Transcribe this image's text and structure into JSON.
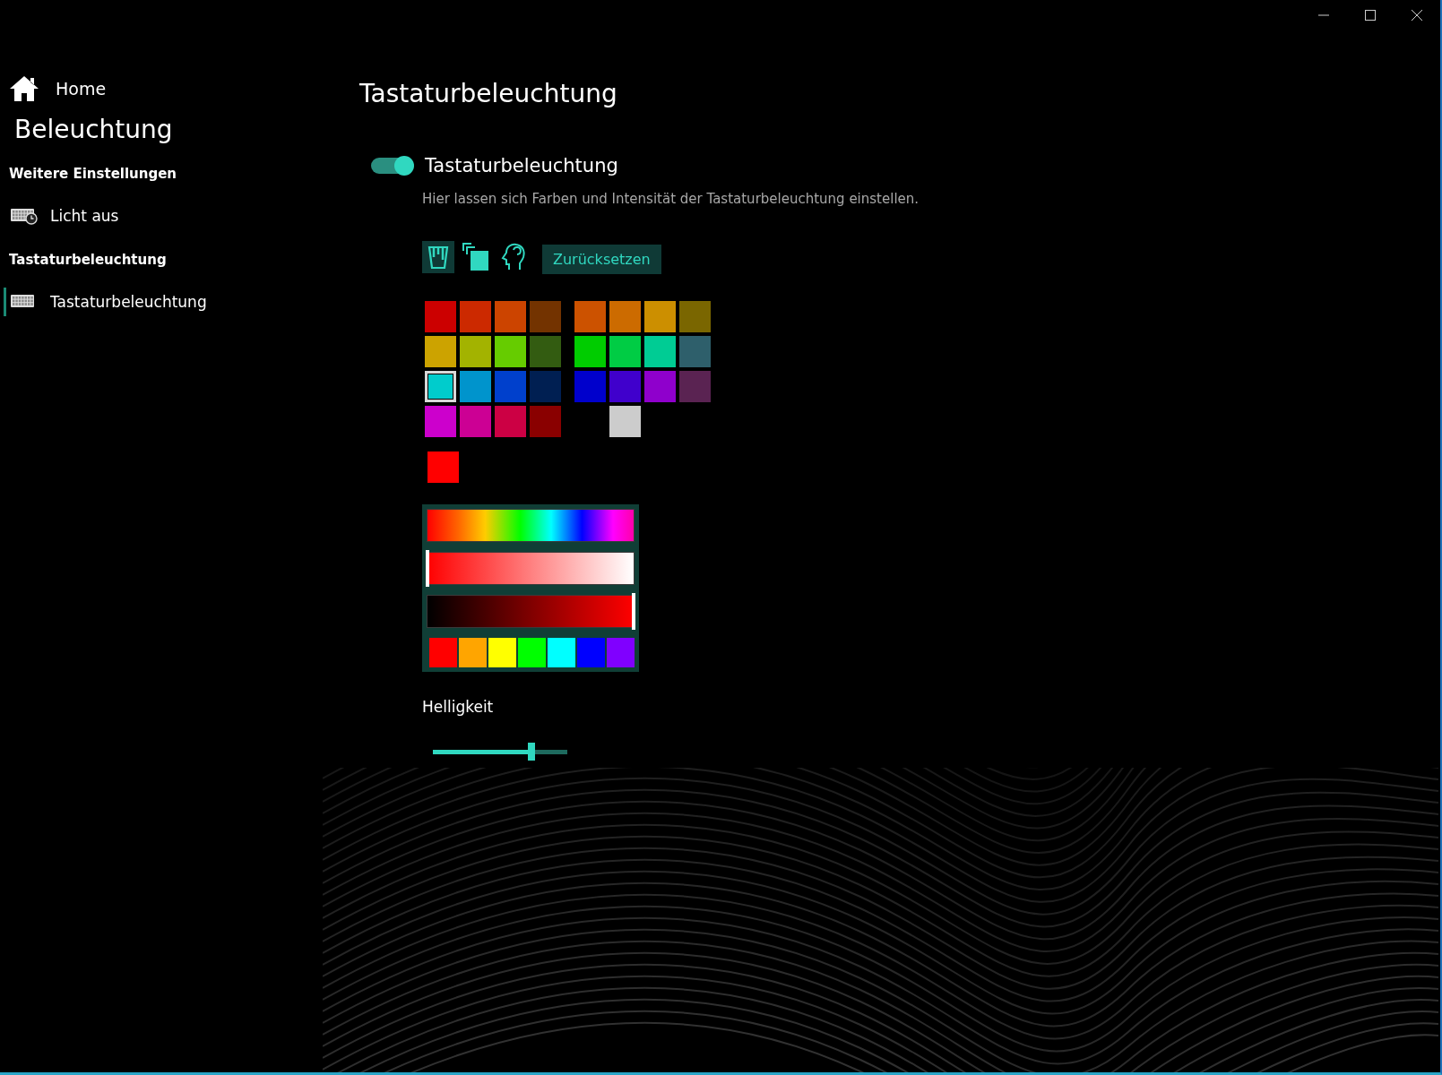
{
  "sidebar": {
    "home": {
      "label": "Home"
    },
    "title": "Beleuchtung",
    "sections": [
      {
        "heading": "Weitere Einstellungen",
        "items": [
          {
            "label": "Licht aus",
            "kind": "keyboard-clock",
            "selected": false
          }
        ]
      },
      {
        "heading": "Tastaturbeleuchtung",
        "items": [
          {
            "label": "Tastaturbeleuchtung",
            "kind": "keyboard",
            "selected": true
          }
        ]
      }
    ]
  },
  "page": {
    "title": "Tastaturbeleuchtung",
    "toggle": {
      "label": "Tastaturbeleuchtung",
      "on": true
    },
    "description": "Hier lassen sich Farben und Intensität der Tastaturbeleuchtung einstellen.",
    "tools": [
      {
        "kind": "bucket",
        "selected": true
      },
      {
        "kind": "copy",
        "selected": false
      },
      {
        "kind": "head",
        "selected": false
      }
    ],
    "reset_button": "Zurücksetzen",
    "swatch_groups": [
      {
        "swatches": [
          {
            "kind": "swatch",
            "color": "#cc0000",
            "selected": false
          },
          {
            "kind": "swatch",
            "color": "#cc2900",
            "selected": false
          },
          {
            "kind": "swatch",
            "color": "#cc4400",
            "selected": false
          },
          {
            "kind": "swatch",
            "color": "#733300",
            "selected": false
          },
          {
            "kind": "swatch",
            "color": "#cca300",
            "selected": false
          },
          {
            "kind": "swatch",
            "color": "#a3b300",
            "selected": false
          },
          {
            "kind": "swatch",
            "color": "#66cc00",
            "selected": false
          },
          {
            "kind": "swatch",
            "color": "#335c11",
            "selected": false
          },
          {
            "kind": "swatch",
            "color": "#00cccc",
            "selected": true
          },
          {
            "kind": "swatch",
            "color": "#0094cc",
            "selected": false
          },
          {
            "kind": "swatch",
            "color": "#0040cc",
            "selected": false
          },
          {
            "kind": "swatch",
            "color": "#001f52",
            "selected": false
          },
          {
            "kind": "swatch",
            "color": "#cc00cc",
            "selected": false
          },
          {
            "kind": "swatch",
            "color": "#cc0094",
            "selected": false
          },
          {
            "kind": "swatch",
            "color": "#cc0044",
            "selected": false
          },
          {
            "kind": "swatch",
            "color": "#8a0000",
            "selected": false
          }
        ]
      },
      {
        "swatches": [
          {
            "kind": "swatch",
            "color": "#cc5200",
            "selected": false
          },
          {
            "kind": "swatch",
            "color": "#cc6b00",
            "selected": false
          },
          {
            "kind": "swatch",
            "color": "#cc8f00",
            "selected": false
          },
          {
            "kind": "swatch",
            "color": "#7a6600",
            "selected": false
          },
          {
            "kind": "swatch",
            "color": "#00cc00",
            "selected": false
          },
          {
            "kind": "swatch",
            "color": "#00cc44",
            "selected": false
          },
          {
            "kind": "swatch",
            "color": "#00cc94",
            "selected": false
          },
          {
            "kind": "swatch",
            "color": "#2e5f6b",
            "selected": false
          },
          {
            "kind": "swatch",
            "color": "#0000cc",
            "selected": false
          },
          {
            "kind": "swatch",
            "color": "#4000cc",
            "selected": false
          },
          {
            "kind": "swatch",
            "color": "#8f00cc",
            "selected": false
          },
          {
            "kind": "swatch",
            "color": "#5a2352",
            "selected": false
          },
          {
            "kind": "blank"
          },
          {
            "kind": "swatch",
            "color": "#cccccc",
            "selected": false
          },
          {
            "kind": "blank"
          },
          {
            "kind": "blank"
          }
        ]
      }
    ],
    "current_color": {
      "color": "#ff0000"
    },
    "picker": {
      "saturation": {
        "level": 0
      },
      "value": {
        "level": 1
      },
      "presets": [
        {
          "color": "#ff0000"
        },
        {
          "color": "#ffa500"
        },
        {
          "color": "#ffff00"
        },
        {
          "color": "#00ff00"
        },
        {
          "color": "#00ffff"
        },
        {
          "color": "#0000ff"
        },
        {
          "color": "#8000ff"
        }
      ]
    },
    "brightness": {
      "label": "Helligkeit",
      "level": 0.73
    }
  }
}
